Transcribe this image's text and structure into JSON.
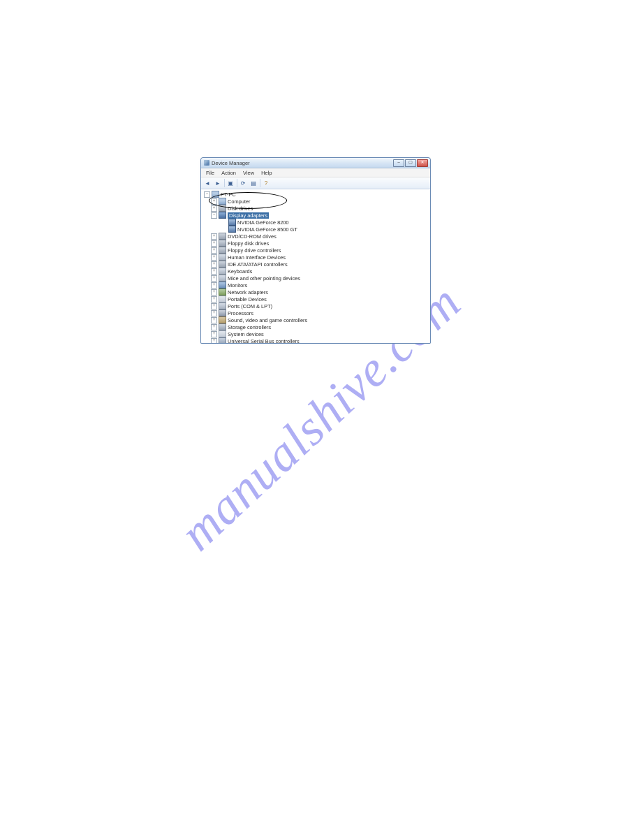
{
  "watermark": "manualshive.com",
  "window": {
    "title": "Device Manager",
    "menus": [
      "File",
      "Action",
      "View",
      "Help"
    ],
    "toolbar_icons": [
      "back",
      "forward",
      "|",
      "properties",
      "|",
      "scan",
      "refresh",
      "|",
      "help"
    ]
  },
  "tree": {
    "root": "PT-PC",
    "items": [
      {
        "label": "Computer",
        "icon": "pc",
        "expanded": false
      },
      {
        "label": "Disk drives",
        "icon": "disk",
        "expanded": false
      },
      {
        "label": "Display adapters",
        "icon": "display",
        "expanded": true,
        "selected": true,
        "children": [
          {
            "label": "NVIDIA GeForce 8200",
            "icon": "gpu"
          },
          {
            "label": "NVIDIA GeForce 8500 GT",
            "icon": "gpu"
          }
        ]
      },
      {
        "label": "DVD/CD-ROM drives",
        "icon": "disk",
        "expanded": false
      },
      {
        "label": "Floppy disk drives",
        "icon": "disk",
        "expanded": false
      },
      {
        "label": "Floppy drive controllers",
        "icon": "disk",
        "expanded": false
      },
      {
        "label": "Human Interface Devices",
        "icon": "hid",
        "expanded": false
      },
      {
        "label": "IDE ATA/ATAPI controllers",
        "icon": "disk",
        "expanded": false
      },
      {
        "label": "Keyboards",
        "icon": "hid",
        "expanded": false
      },
      {
        "label": "Mice and other pointing devices",
        "icon": "hid",
        "expanded": false
      },
      {
        "label": "Monitors",
        "icon": "mon",
        "expanded": false
      },
      {
        "label": "Network adapters",
        "icon": "net",
        "expanded": false
      },
      {
        "label": "Portable Devices",
        "icon": "generic",
        "expanded": false
      },
      {
        "label": "Ports (COM & LPT)",
        "icon": "port",
        "expanded": false
      },
      {
        "label": "Processors",
        "icon": "proc",
        "expanded": false
      },
      {
        "label": "Sound, video and game controllers",
        "icon": "sound",
        "expanded": false
      },
      {
        "label": "Storage controllers",
        "icon": "disk",
        "expanded": false
      },
      {
        "label": "System devices",
        "icon": "generic",
        "expanded": false
      },
      {
        "label": "Universal Serial Bus controllers",
        "icon": "usb",
        "expanded": false
      }
    ]
  }
}
